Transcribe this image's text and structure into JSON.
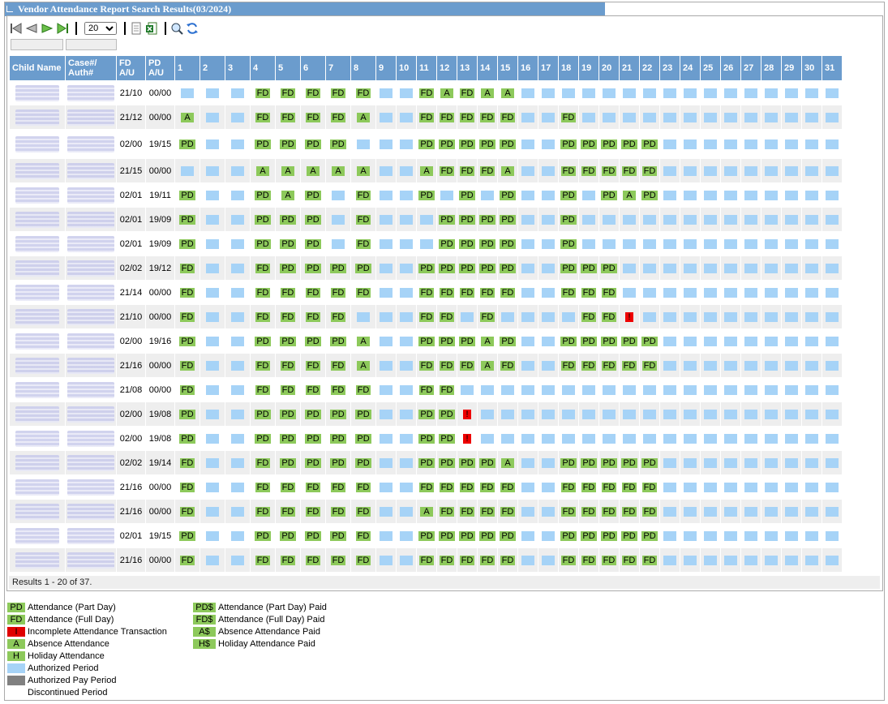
{
  "title": "Vendor Attendance Report Search Results(03/2024)",
  "toolbar": {
    "page_size": "20",
    "page_size_options": [
      "20"
    ]
  },
  "columns": {
    "child": "Child Name",
    "case": "Case#/ Auth#",
    "fd": "FD A/U",
    "pd": "PD A/U",
    "days": [
      "1",
      "2",
      "3",
      "4",
      "5",
      "6",
      "7",
      "8",
      "9",
      "10",
      "11",
      "12",
      "13",
      "14",
      "15",
      "16",
      "17",
      "18",
      "19",
      "20",
      "21",
      "22",
      "23",
      "24",
      "25",
      "26",
      "27",
      "28",
      "29",
      "30",
      "31"
    ]
  },
  "rows": [
    {
      "fd": "21/10",
      "pd": "00/00",
      "days": [
        "B",
        "B",
        "B",
        "FD",
        "FD",
        "FD",
        "FD",
        "FD",
        "B",
        "B",
        "FD",
        "A",
        "FD",
        "A",
        "A",
        "B",
        "B",
        "B",
        "B",
        "B",
        "B",
        "B",
        "B",
        "B",
        "B",
        "B",
        "B",
        "B",
        "B",
        "B",
        "B"
      ]
    },
    {
      "fd": "21/12",
      "pd": "00/00",
      "days": [
        "A",
        "B",
        "B",
        "FD",
        "FD",
        "FD",
        "FD",
        "A",
        "B",
        "B",
        "FD",
        "FD",
        "FD",
        "FD",
        "FD",
        "B",
        "B",
        "FD",
        "B",
        "B",
        "B",
        "B",
        "B",
        "B",
        "B",
        "B",
        "B",
        "B",
        "B",
        "B",
        "B"
      ]
    },
    {
      "fd": "02/00",
      "pd": "19/15",
      "days": [
        "PD",
        "B",
        "B",
        "PD",
        "PD",
        "PD",
        "PD",
        "B",
        "B",
        "B",
        "PD",
        "PD",
        "PD",
        "PD",
        "PD",
        "B",
        "B",
        "PD",
        "PD",
        "PD",
        "PD",
        "PD",
        "B",
        "B",
        "B",
        "B",
        "B",
        "B",
        "B",
        "B",
        "B"
      ]
    },
    {
      "fd": "21/15",
      "pd": "00/00",
      "days": [
        "B",
        "B",
        "B",
        "A",
        "A",
        "A",
        "A",
        "A",
        "B",
        "B",
        "A",
        "FD",
        "FD",
        "FD",
        "A",
        "B",
        "B",
        "FD",
        "FD",
        "FD",
        "FD",
        "FD",
        "B",
        "B",
        "B",
        "B",
        "B",
        "B",
        "B",
        "B",
        "B"
      ]
    },
    {
      "fd": "02/01",
      "pd": "19/11",
      "days": [
        "PD",
        "B",
        "B",
        "PD",
        "A",
        "PD",
        "B",
        "FD",
        "B",
        "B",
        "PD",
        "B",
        "PD",
        "B",
        "PD",
        "B",
        "B",
        "PD",
        "B",
        "PD",
        "A",
        "PD",
        "B",
        "B",
        "B",
        "B",
        "B",
        "B",
        "B",
        "B",
        "B"
      ]
    },
    {
      "fd": "02/01",
      "pd": "19/09",
      "days": [
        "PD",
        "B",
        "B",
        "PD",
        "PD",
        "PD",
        "B",
        "FD",
        "B",
        "B",
        "B",
        "PD",
        "PD",
        "PD",
        "PD",
        "B",
        "B",
        "PD",
        "B",
        "B",
        "B",
        "B",
        "B",
        "B",
        "B",
        "B",
        "B",
        "B",
        "B",
        "B",
        "B"
      ]
    },
    {
      "fd": "02/01",
      "pd": "19/09",
      "days": [
        "PD",
        "B",
        "B",
        "PD",
        "PD",
        "PD",
        "B",
        "FD",
        "B",
        "B",
        "B",
        "PD",
        "PD",
        "PD",
        "PD",
        "B",
        "B",
        "PD",
        "B",
        "B",
        "B",
        "B",
        "B",
        "B",
        "B",
        "B",
        "B",
        "B",
        "B",
        "B",
        "B"
      ]
    },
    {
      "fd": "02/02",
      "pd": "19/12",
      "days": [
        "FD",
        "B",
        "B",
        "FD",
        "PD",
        "PD",
        "PD",
        "PD",
        "B",
        "B",
        "PD",
        "PD",
        "PD",
        "PD",
        "PD",
        "B",
        "B",
        "PD",
        "PD",
        "PD",
        "B",
        "B",
        "B",
        "B",
        "B",
        "B",
        "B",
        "B",
        "B",
        "B",
        "B"
      ]
    },
    {
      "fd": "21/14",
      "pd": "00/00",
      "days": [
        "FD",
        "B",
        "B",
        "FD",
        "FD",
        "FD",
        "FD",
        "FD",
        "B",
        "B",
        "FD",
        "FD",
        "FD",
        "FD",
        "FD",
        "B",
        "B",
        "FD",
        "FD",
        "FD",
        "B",
        "B",
        "B",
        "B",
        "B",
        "B",
        "B",
        "B",
        "B",
        "B",
        "B"
      ]
    },
    {
      "fd": "21/10",
      "pd": "00/00",
      "days": [
        "FD",
        "B",
        "B",
        "FD",
        "FD",
        "FD",
        "FD",
        "B",
        "B",
        "B",
        "FD",
        "FD",
        "B",
        "FD",
        "B",
        "B",
        "B",
        "B",
        "FD",
        "FD",
        "I",
        "B",
        "B",
        "B",
        "B",
        "B",
        "B",
        "B",
        "B",
        "B",
        "B"
      ]
    },
    {
      "fd": "02/00",
      "pd": "19/16",
      "days": [
        "PD",
        "B",
        "B",
        "PD",
        "PD",
        "PD",
        "PD",
        "A",
        "B",
        "B",
        "PD",
        "PD",
        "PD",
        "A",
        "PD",
        "B",
        "B",
        "PD",
        "PD",
        "PD",
        "PD",
        "PD",
        "B",
        "B",
        "B",
        "B",
        "B",
        "B",
        "B",
        "B",
        "B"
      ]
    },
    {
      "fd": "21/16",
      "pd": "00/00",
      "days": [
        "FD",
        "B",
        "B",
        "FD",
        "FD",
        "FD",
        "FD",
        "A",
        "B",
        "B",
        "FD",
        "FD",
        "FD",
        "A",
        "FD",
        "B",
        "B",
        "FD",
        "FD",
        "FD",
        "FD",
        "FD",
        "B",
        "B",
        "B",
        "B",
        "B",
        "B",
        "B",
        "B",
        "B"
      ]
    },
    {
      "fd": "21/08",
      "pd": "00/00",
      "days": [
        "FD",
        "B",
        "B",
        "FD",
        "FD",
        "FD",
        "FD",
        "FD",
        "B",
        "B",
        "FD",
        "FD",
        "B",
        "B",
        "B",
        "B",
        "B",
        "B",
        "B",
        "B",
        "B",
        "B",
        "B",
        "B",
        "B",
        "B",
        "B",
        "B",
        "B",
        "B",
        "B"
      ]
    },
    {
      "fd": "02/00",
      "pd": "19/08",
      "days": [
        "PD",
        "B",
        "B",
        "PD",
        "PD",
        "PD",
        "PD",
        "PD",
        "B",
        "B",
        "PD",
        "PD",
        "I",
        "B",
        "B",
        "B",
        "B",
        "B",
        "B",
        "B",
        "B",
        "B",
        "B",
        "B",
        "B",
        "B",
        "B",
        "B",
        "B",
        "B",
        "B"
      ]
    },
    {
      "fd": "02/00",
      "pd": "19/08",
      "days": [
        "PD",
        "B",
        "B",
        "PD",
        "PD",
        "PD",
        "PD",
        "PD",
        "B",
        "B",
        "PD",
        "PD",
        "I",
        "B",
        "B",
        "B",
        "B",
        "B",
        "B",
        "B",
        "B",
        "B",
        "B",
        "B",
        "B",
        "B",
        "B",
        "B",
        "B",
        "B",
        "B"
      ]
    },
    {
      "fd": "02/02",
      "pd": "19/14",
      "days": [
        "FD",
        "B",
        "B",
        "FD",
        "PD",
        "PD",
        "PD",
        "PD",
        "B",
        "B",
        "PD",
        "PD",
        "PD",
        "PD",
        "A",
        "B",
        "B",
        "PD",
        "PD",
        "PD",
        "PD",
        "PD",
        "B",
        "B",
        "B",
        "B",
        "B",
        "B",
        "B",
        "B",
        "B"
      ]
    },
    {
      "fd": "21/16",
      "pd": "00/00",
      "days": [
        "FD",
        "B",
        "B",
        "FD",
        "FD",
        "FD",
        "FD",
        "FD",
        "B",
        "B",
        "FD",
        "FD",
        "FD",
        "FD",
        "FD",
        "B",
        "B",
        "FD",
        "FD",
        "FD",
        "FD",
        "FD",
        "B",
        "B",
        "B",
        "B",
        "B",
        "B",
        "B",
        "B",
        "B"
      ]
    },
    {
      "fd": "21/16",
      "pd": "00/00",
      "days": [
        "FD",
        "B",
        "B",
        "FD",
        "FD",
        "FD",
        "FD",
        "FD",
        "B",
        "B",
        "A",
        "FD",
        "FD",
        "FD",
        "FD",
        "B",
        "B",
        "FD",
        "FD",
        "FD",
        "FD",
        "FD",
        "B",
        "B",
        "B",
        "B",
        "B",
        "B",
        "B",
        "B",
        "B"
      ]
    },
    {
      "fd": "02/01",
      "pd": "19/15",
      "days": [
        "PD",
        "B",
        "B",
        "PD",
        "PD",
        "PD",
        "PD",
        "FD",
        "B",
        "B",
        "PD",
        "PD",
        "PD",
        "PD",
        "PD",
        "B",
        "B",
        "PD",
        "PD",
        "PD",
        "PD",
        "PD",
        "B",
        "B",
        "B",
        "B",
        "B",
        "B",
        "B",
        "B",
        "B"
      ]
    },
    {
      "fd": "21/16",
      "pd": "00/00",
      "days": [
        "FD",
        "B",
        "B",
        "FD",
        "FD",
        "FD",
        "FD",
        "FD",
        "B",
        "B",
        "FD",
        "FD",
        "FD",
        "FD",
        "FD",
        "B",
        "B",
        "FD",
        "FD",
        "FD",
        "FD",
        "FD",
        "B",
        "B",
        "B",
        "B",
        "B",
        "B",
        "B",
        "B",
        "B"
      ]
    }
  ],
  "results_text": "Results 1 - 20 of 37.",
  "legend_left": [
    {
      "code": "PD",
      "label": "Attendance (Part Day)",
      "color": "#8dc95b"
    },
    {
      "code": "FD",
      "label": "Attendance (Full Day)",
      "color": "#8dc95b"
    },
    {
      "code": "I",
      "label": "Incomplete Attendance Transaction",
      "color": "#e00000"
    },
    {
      "code": "A",
      "label": "Absence Attendance",
      "color": "#8dc95b"
    },
    {
      "code": "H",
      "label": "Holiday Attendance",
      "color": "#8dc95b"
    },
    {
      "code": "",
      "label": "Authorized Period",
      "color": "#a6d3f7"
    },
    {
      "code": "",
      "label": "Authorized Pay Period",
      "color": "#808080"
    },
    {
      "code": "",
      "label": "Discontinued Period",
      "color": "#ffffff"
    }
  ],
  "legend_right": [
    {
      "code": "PD$",
      "label": "Attendance (Part Day) Paid",
      "color": "#8dc95b"
    },
    {
      "code": "FD$",
      "label": "Attendance (Full Day) Paid",
      "color": "#8dc95b"
    },
    {
      "code": "A$",
      "label": "Absence Attendance Paid",
      "color": "#8dc95b"
    },
    {
      "code": "H$",
      "label": "Holiday Attendance Paid",
      "color": "#8dc95b"
    }
  ]
}
